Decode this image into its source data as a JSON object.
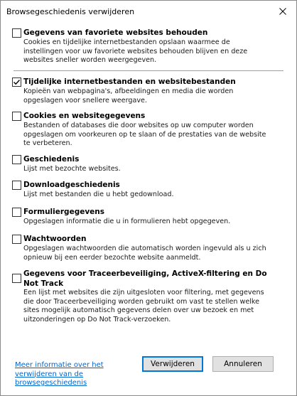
{
  "window": {
    "title": "Browsegeschiedenis verwijderen"
  },
  "options": [
    {
      "label": "Gegevens van favoriete websites behouden",
      "checked": false,
      "description": "Cookies en tijdelijke internetbestanden opslaan waarmee de instellingen voor uw favoriete websites behouden blijven en deze websites sneller worden weergegeven."
    },
    {
      "label": "Tijdelijke internetbestanden en websitebestanden",
      "checked": true,
      "description": "Kopieën van webpagina's, afbeeldingen en media die worden opgeslagen voor snellere weergave."
    },
    {
      "label": "Cookies en websitegegevens",
      "checked": false,
      "description": "Bestanden of databases die door websites op uw computer worden opgeslagen om voorkeuren op te slaan of de prestaties van de website te verbeteren."
    },
    {
      "label": "Geschiedenis",
      "checked": false,
      "description": "Lijst met bezochte websites."
    },
    {
      "label": "Downloadgeschiedenis",
      "checked": false,
      "description": "Lijst met bestanden die u hebt gedownload."
    },
    {
      "label": "Formuliergegevens",
      "checked": false,
      "description": "Opgeslagen informatie die u in formulieren hebt opgegeven."
    },
    {
      "label": "Wachtwoorden",
      "checked": false,
      "description": "Opgeslagen wachtwoorden die automatisch worden ingevuld als u zich opnieuw bij een eerder bezochte website aanmeldt."
    },
    {
      "label": "Gegevens voor Traceerbeveiliging, ActiveX-filtering en Do Not Track",
      "checked": false,
      "description": "Een lijst met websites die zijn uitgesloten voor filtering, met gegevens die door Traceerbeveiliging worden gebruikt om vast te stellen welke sites mogelijk automatisch gegevens delen over uw bezoek en met uitzonderingen op Do Not Track-verzoeken."
    }
  ],
  "footer": {
    "more_info_link": "Meer informatie over het verwijderen van de browsegeschiedenis",
    "delete_button": "Verwijderen",
    "cancel_button": "Annuleren"
  },
  "colors": {
    "link": "#0066cc",
    "primary_border": "#0078d7"
  }
}
